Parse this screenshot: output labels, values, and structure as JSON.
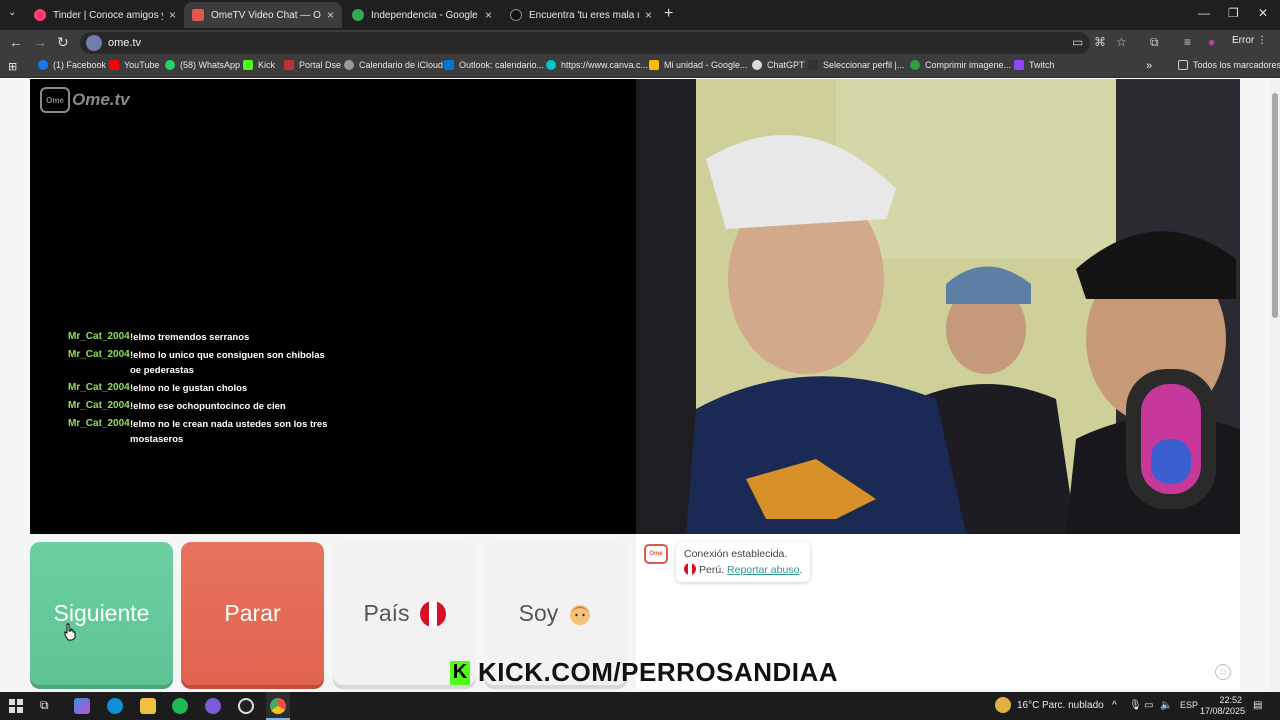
{
  "browser": {
    "tabs": [
      {
        "title": "Tinder | Conoce amigos y gente",
        "color": "#fe3c72"
      },
      {
        "title": "OmeTV Video Chat — Ome",
        "color": "#e0584a"
      },
      {
        "title": "Independencia - Google Maps",
        "color": "#34a853"
      },
      {
        "title": "Encuentra 'tu eres mala mala d",
        "color": "#111111"
      }
    ],
    "url": "ome.tv",
    "error_label": "Error",
    "bookmarks": [
      {
        "label": "(1) Facebook",
        "color": "#1877f2"
      },
      {
        "label": "YouTube",
        "color": "#ff0000"
      },
      {
        "label": "(58) WhatsApp",
        "color": "#25d366"
      },
      {
        "label": "Kick",
        "color": "#53fc18"
      },
      {
        "label": "Portal Dse",
        "color": "#c03030"
      },
      {
        "label": "Calendario de iCloud",
        "color": "#999999"
      },
      {
        "label": "Outlook: calendario...",
        "color": "#0078d4"
      },
      {
        "label": "https://www.canva.c...",
        "color": "#00c4cc"
      },
      {
        "label": "Mi unidad - Google...",
        "color": "#fbbc04"
      },
      {
        "label": "ChatGPT",
        "color": "#dddddd"
      },
      {
        "label": "Seleccionar perfil |...",
        "color": "#333333"
      },
      {
        "label": "Comprimir imagene...",
        "color": "#2ea043"
      },
      {
        "label": "Twitch",
        "color": "#9146ff"
      }
    ],
    "all_bookmarks": "Todos los marcadores"
  },
  "ometv": {
    "logo": "Ome.tv",
    "chat": [
      {
        "user": "Mr_Cat_2004",
        "text": "!elmo tremendos serranos"
      },
      {
        "user": "Mr_Cat_2004",
        "text": "!elmo lo unico que consiguen son chibolas oe pederastas"
      },
      {
        "user": "Mr_Cat_2004",
        "text": "!elmo no le gustan cholos"
      },
      {
        "user": "Mr_Cat_2004",
        "text": "!elmo ese ochopuntocinco de cien"
      },
      {
        "user": "Mr_Cat_2004",
        "text": "!elmo no le crean nada ustedes son los tres mostaseros"
      }
    ],
    "buttons": {
      "next": "Siguiente",
      "stop": "Parar",
      "country": "País",
      "gender": "Soy"
    },
    "system_message": {
      "line1": "Conexión establecida.",
      "country": "Perú.",
      "report": "Reportar abuso",
      "period": "."
    }
  },
  "overlay": {
    "kick_text": "KICK.COM/PERROSANDIAA"
  },
  "taskbar": {
    "temperature": "16°C",
    "weather": "Parc. nublado",
    "language": "ESP",
    "time": "22:52",
    "date": "17/08/2025"
  }
}
